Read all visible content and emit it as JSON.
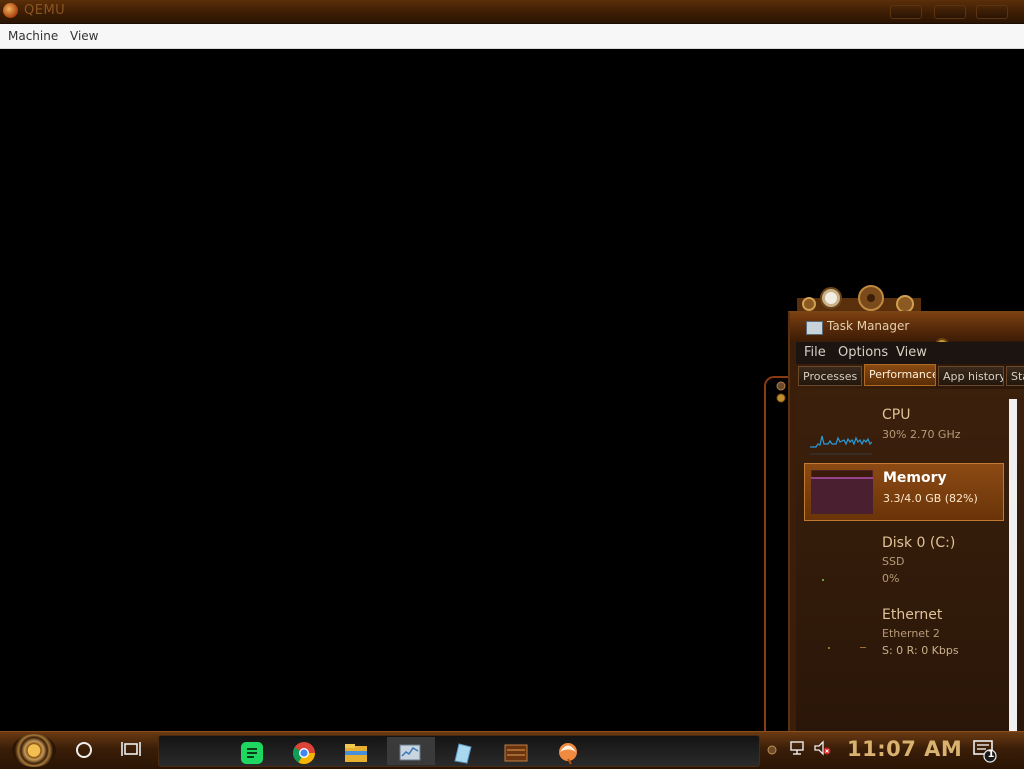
{
  "window": {
    "title": "QEMU"
  },
  "menubar": {
    "items": [
      "Machine",
      "View"
    ]
  },
  "task_manager": {
    "title": "Task Manager",
    "menu": [
      "File",
      "Options",
      "View"
    ],
    "tabs": [
      "Processes",
      "Performance",
      "App history",
      "Sta"
    ],
    "active_tab": "Performance",
    "items": [
      {
        "name": "CPU",
        "lines": [
          "30% 2.70 GHz"
        ]
      },
      {
        "name": "Memory",
        "lines": [
          "3.3/4.0 GB (82%)"
        ],
        "selected": true
      },
      {
        "name": "Disk 0 (C:)",
        "lines": [
          "SSD",
          "0%"
        ]
      },
      {
        "name": "Ethernet",
        "lines": [
          "Ethernet 2",
          "S: 0 R: 0 Kbps"
        ]
      }
    ]
  },
  "taskbar": {
    "apps": [
      "spotify-icon",
      "chrome-icon",
      "file-explorer-icon",
      "task-manager-icon",
      "app-icon",
      "calendar-icon",
      "qemu-icon"
    ],
    "clock": "11:07 AM",
    "notification_count": "1"
  },
  "colors": {
    "accent": "#8c4a14",
    "clock": "#d9b270",
    "title_bar": "#5a2f08"
  }
}
